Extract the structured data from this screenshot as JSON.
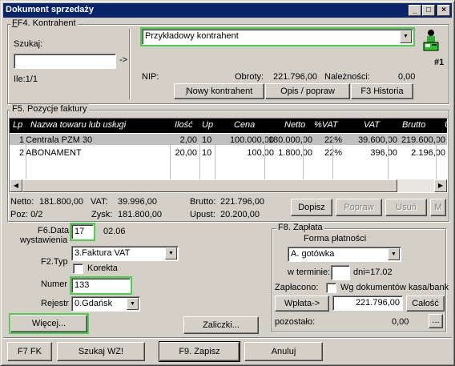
{
  "window": {
    "title": "Dokument sprzedaży",
    "minimize_icon": "minimize-icon",
    "maximize_icon": "maximize-icon",
    "close_icon": "close-icon"
  },
  "kontrahent": {
    "group_label": "F4. Kontrahent",
    "search_label": "Szukaj:",
    "search_value": "",
    "arrow_label": "->",
    "count_label": "Ile:1/1",
    "selected": "Przykładowy kontrahent",
    "nip_label": "NIP:",
    "obroty_label": "Obroty:",
    "obroty_value": "221.796,00",
    "naleznosci_label": "Należności:",
    "naleznosci_value": "0,00",
    "cashier_label": "#1",
    "buttons": {
      "nowy": "Nowy kontrahent",
      "opis": "Opis / popraw",
      "historia": "F3 Historia"
    }
  },
  "pozycje": {
    "group_label": "F5. Pozycje faktury",
    "columns": [
      "Lp",
      "Nazwa towaru lub usługi",
      "Ilość",
      "Up",
      "Cena",
      "Netto",
      "%VAT",
      "VAT",
      "Brutto",
      "U"
    ],
    "rows": [
      [
        "1",
        "Centrala PZM 30",
        "2,00",
        "10",
        "100.000,00",
        "180.000,00",
        "22%",
        "39.600,00",
        "219.600,00"
      ],
      [
        "2",
        "ABONAMENT",
        "20,00",
        "10",
        "100,00",
        "1.800,00",
        "22%",
        "396,00",
        "2.196,00"
      ]
    ],
    "summary": {
      "netto_label": "Netto:",
      "netto_value": "181.800,00",
      "vat_label": "VAT:",
      "vat_value": "39.996,00",
      "brutto_label": "Brutto:",
      "brutto_value": "221.796,00",
      "poz_label": "Poz: 0/2",
      "zysk_label": "Zysk:",
      "zysk_value": "181.800,00",
      "upust_label": "Upust:",
      "upust_value": "20.200,00"
    },
    "buttons": {
      "dopisz": "Dopisz",
      "popraw": "Popraw",
      "usun": "Usuń",
      "m": "M"
    }
  },
  "dokument": {
    "data_label_1": "F6.Data",
    "data_label_2": "wystawienia",
    "data_day": "17",
    "data_month": "02.06",
    "typ_label": "F2.Typ",
    "typ_value": "3.Faktura VAT",
    "korekta_label": "Korekta",
    "numer_label": "Numer",
    "numer_value": "133",
    "rejestr_label": "Rejestr",
    "rejestr_value": "0.Gdańsk",
    "wiecej": "Więcej...",
    "zaliczki": "Zaliczki..."
  },
  "zaplata": {
    "group_label": "F8. Zapłata",
    "forma_label": "Forma płatności",
    "forma_value": "A. gotówka",
    "termin_label": "w terminie:",
    "termin_value": "",
    "dni_label": "dni=17.02",
    "zaplacono_label": "Zapłacono:",
    "wg_label": "Wg dokumentów kasa/bank",
    "wplata_button": "Wpłata->",
    "wplata_value": "221.796,00",
    "calosc_button": "Całość",
    "pozostalo_label": "pozostało:",
    "pozostalo_value": "0,00",
    "more_button": "..."
  },
  "bottom": {
    "fk": "F7 FK",
    "szukaj": "Szukaj WZ!",
    "zapisz": "F9. Zapisz",
    "anuluj": "Anuluj"
  },
  "icons": {
    "cashier": "cashier-icon",
    "combo_arrow": "chevron-down-icon"
  }
}
